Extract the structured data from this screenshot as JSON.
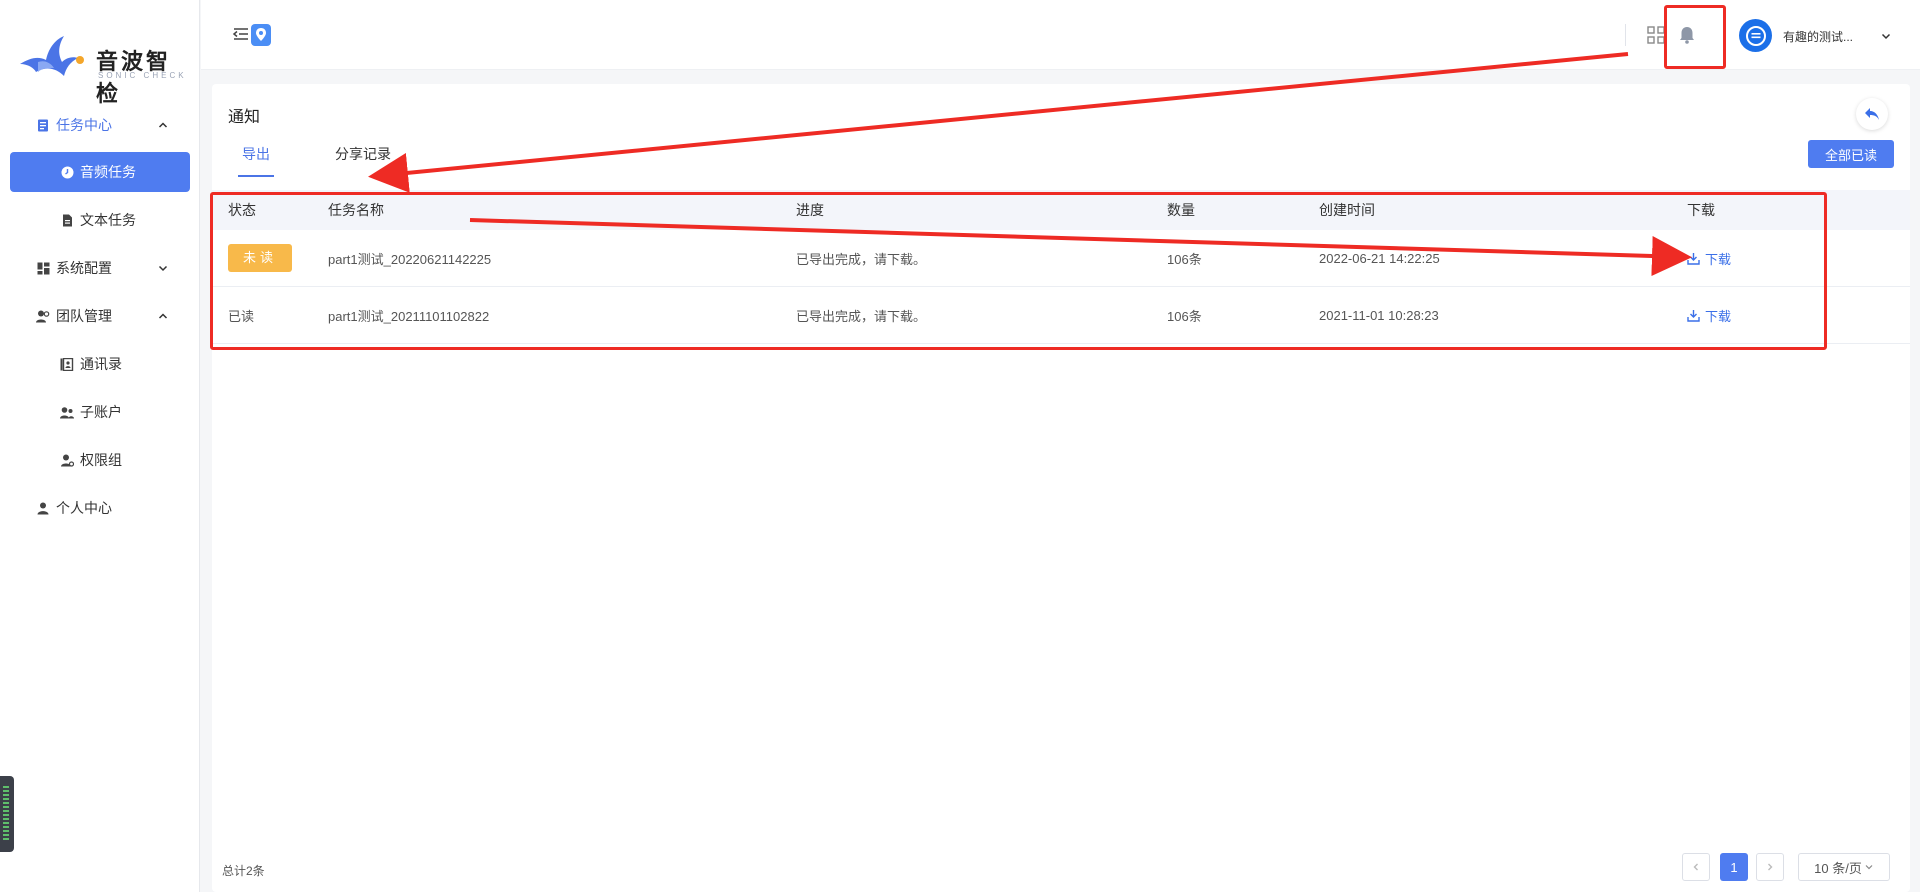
{
  "brand": {
    "title": "音波智检",
    "subtitle": "SONIC CHECK"
  },
  "sidebar": {
    "items": [
      {
        "label": "任务中心",
        "icon": "task-doc-icon"
      },
      {
        "label": "音频任务",
        "icon": "clock-icon"
      },
      {
        "label": "文本任务",
        "icon": "document-icon"
      },
      {
        "label": "系统配置",
        "icon": "dashboard-icon"
      },
      {
        "label": "团队管理",
        "icon": "team-icon"
      },
      {
        "label": "通讯录",
        "icon": "contacts-icon"
      },
      {
        "label": "子账户",
        "icon": "sub-account-icon"
      },
      {
        "label": "权限组",
        "icon": "permission-icon"
      },
      {
        "label": "个人中心",
        "icon": "user-icon"
      }
    ]
  },
  "header": {
    "username": "有趣的测试..."
  },
  "panel": {
    "title": "通知",
    "tabs": [
      "导出",
      "分享记录"
    ],
    "read_all": "全部已读"
  },
  "table": {
    "columns": [
      "状态",
      "任务名称",
      "进度",
      "数量",
      "创建时间",
      "下载"
    ],
    "rows": [
      {
        "status": "未读",
        "name": "part1测试_20220621142225",
        "progress": "已导出完成，请下载。",
        "count": "106条",
        "time": "2022-06-21 14:22:25",
        "download": "下载"
      },
      {
        "status": "已读",
        "name": "part1测试_20211101102822",
        "progress": "已导出完成，请下载。",
        "count": "106条",
        "time": "2021-11-01 10:28:23",
        "download": "下载"
      }
    ]
  },
  "pagination": {
    "total": "总计2条",
    "current": "1",
    "page_size": "10 条/页"
  },
  "colors": {
    "accent": "#4f7cf0",
    "unread": "#f8b94a",
    "annotation": "#ee2b24"
  }
}
